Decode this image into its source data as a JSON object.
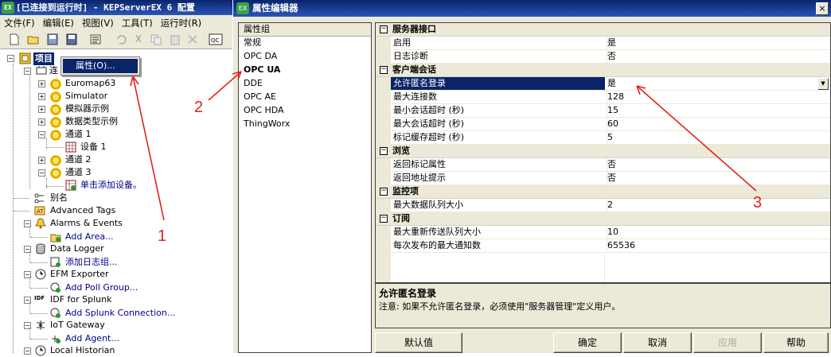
{
  "main": {
    "title": "[已连接到运行时] - KEPServerEX 6 配置",
    "app_icon_text": "EX",
    "menu": [
      "文件(F)",
      "编辑(E)",
      "视图(V)",
      "工具(T)",
      "运行时(R)"
    ],
    "tree": {
      "root": "项目",
      "connectivity_partial": "连",
      "channels": [
        "Euromap63",
        "Simulator",
        "模拟器示例",
        "数据类型示例",
        "通道 1",
        "通道 2",
        "通道 3"
      ],
      "device_1": "设备 1",
      "add_device": "单击添加设备。",
      "aliases": "别名",
      "advanced_tags": "Advanced Tags",
      "alarms_events": "Alarms & Events",
      "add_area": "Add Area...",
      "data_logger": "Data Logger",
      "add_log_group": "添加日志组...",
      "efm_exporter": "EFM Exporter",
      "add_poll_group": "Add Poll Group...",
      "idf_splunk": "IDF for Splunk",
      "add_splunk": "Add Splunk Connection...",
      "iot_gateway": "IoT Gateway",
      "add_agent": "Add Agent...",
      "local_historian": "Local Historian"
    },
    "context_menu": {
      "properties": "属性(O)..."
    }
  },
  "dialog": {
    "title": "属性编辑器",
    "close": "×",
    "groups_header": "属性组",
    "groups": [
      "常规",
      "OPC DA",
      "OPC UA",
      "DDE",
      "OPC AE",
      "OPC HDA",
      "ThingWorx"
    ],
    "selected_group": "OPC UA",
    "categories": [
      {
        "label": "服务器接口",
        "rows": [
          {
            "name": "启用",
            "value": "是"
          },
          {
            "name": "日志诊断",
            "value": "否"
          }
        ]
      },
      {
        "label": "客户端会话",
        "rows": [
          {
            "name": "允许匿名登录",
            "value": "是"
          },
          {
            "name": "最大连接数",
            "value": "128"
          },
          {
            "name": "最小会话超时 (秒)",
            "value": "15"
          },
          {
            "name": "最大会话超时 (秒)",
            "value": "60"
          },
          {
            "name": "标记缓存超时 (秒)",
            "value": "5"
          }
        ]
      },
      {
        "label": "浏览",
        "rows": [
          {
            "name": "返回标记属性",
            "value": "否"
          },
          {
            "name": "返回地址提示",
            "value": "否"
          }
        ]
      },
      {
        "label": "监控项",
        "rows": [
          {
            "name": "最大数据队列大小",
            "value": "2"
          }
        ]
      },
      {
        "label": "订阅",
        "rows": [
          {
            "name": "最大重新传送队列大小",
            "value": "10"
          },
          {
            "name": "每次发布的最大通知数",
            "value": "65536"
          }
        ]
      }
    ],
    "selected_property": "允许匿名登录",
    "description": {
      "title": "允许匿名登录",
      "text": "注意: 如果不允许匿名登录，必须使用\"服务器管理\"定义用户。"
    },
    "buttons": {
      "defaults": "默认值",
      "ok": "确定",
      "cancel": "取消",
      "apply": "应用",
      "help": "帮助"
    }
  },
  "annotations": {
    "a1": "1",
    "a2": "2",
    "a3": "3",
    "color": "#e2231a"
  }
}
